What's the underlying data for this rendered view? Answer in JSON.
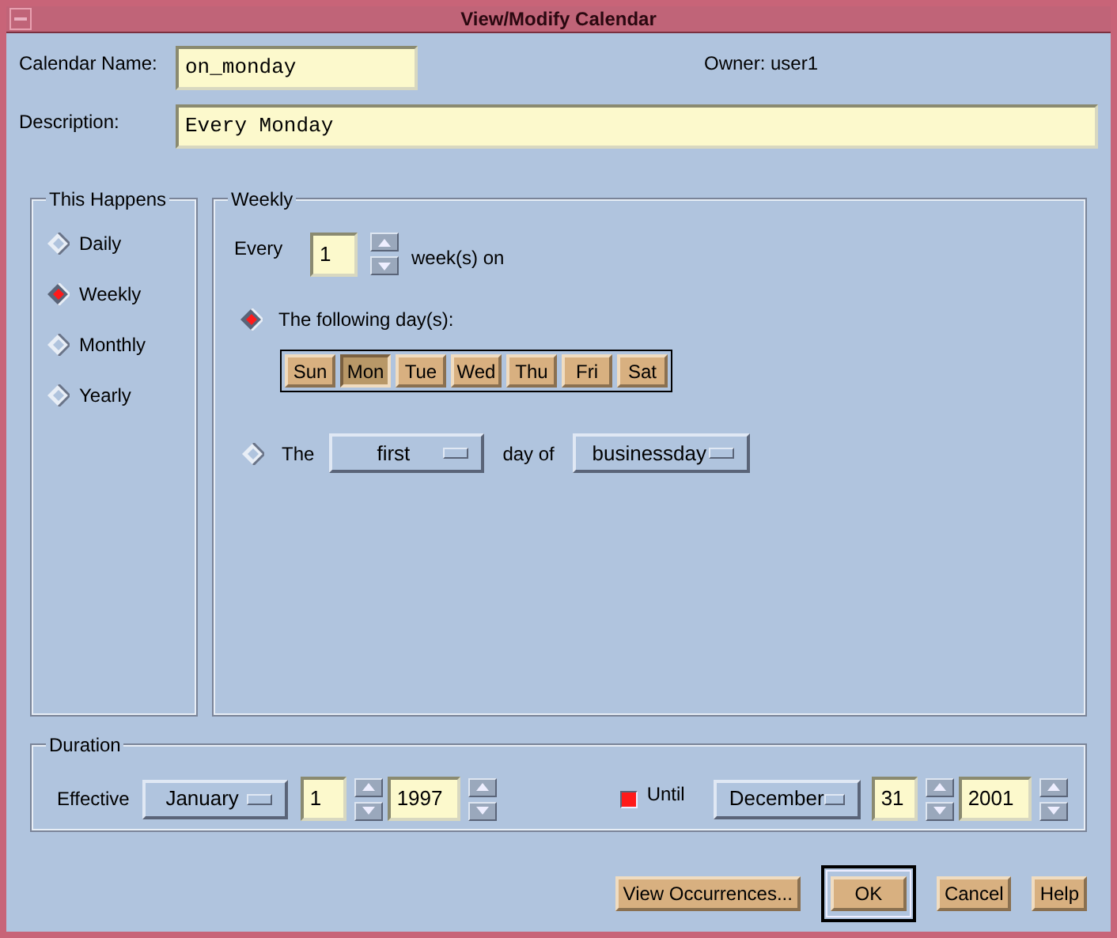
{
  "window": {
    "title": "View/Modify Calendar"
  },
  "calendar_name": {
    "label": "Calendar Name:",
    "value": "on_monday"
  },
  "owner": "Owner: user1",
  "description": {
    "label": "Description:",
    "value": "Every Monday"
  },
  "this_happens": {
    "title": "This Happens",
    "options": [
      {
        "label": "Daily",
        "selected": false
      },
      {
        "label": "Weekly",
        "selected": true
      },
      {
        "label": "Monthly",
        "selected": false
      },
      {
        "label": "Yearly",
        "selected": false
      }
    ]
  },
  "weekly": {
    "title": "Weekly",
    "every_label": "Every",
    "every_value": "1",
    "weeks_label": "week(s) on",
    "following": {
      "label": "The following day(s):",
      "selected": true
    },
    "days": [
      {
        "label": "Sun",
        "selected": false
      },
      {
        "label": "Mon",
        "selected": true
      },
      {
        "label": "Tue",
        "selected": false
      },
      {
        "label": "Wed",
        "selected": false
      },
      {
        "label": "Thu",
        "selected": false
      },
      {
        "label": "Fri",
        "selected": false
      },
      {
        "label": "Sat",
        "selected": false
      }
    ],
    "the": {
      "label": "The",
      "selected": false,
      "ordinal": "first",
      "day_of_label": "day of",
      "day_type": "businessday"
    }
  },
  "duration": {
    "title": "Duration",
    "effective_label": "Effective",
    "effective_month": "January",
    "effective_day": "1",
    "effective_year": "1997",
    "until": {
      "label": "Until",
      "checked": true
    },
    "until_month": "December",
    "until_day": "31",
    "until_year": "2001"
  },
  "buttons": [
    {
      "label": "View Occurrences...",
      "default": false
    },
    {
      "label": "OK",
      "default": true
    },
    {
      "label": "Cancel",
      "default": false
    },
    {
      "label": "Help",
      "default": false
    }
  ]
}
